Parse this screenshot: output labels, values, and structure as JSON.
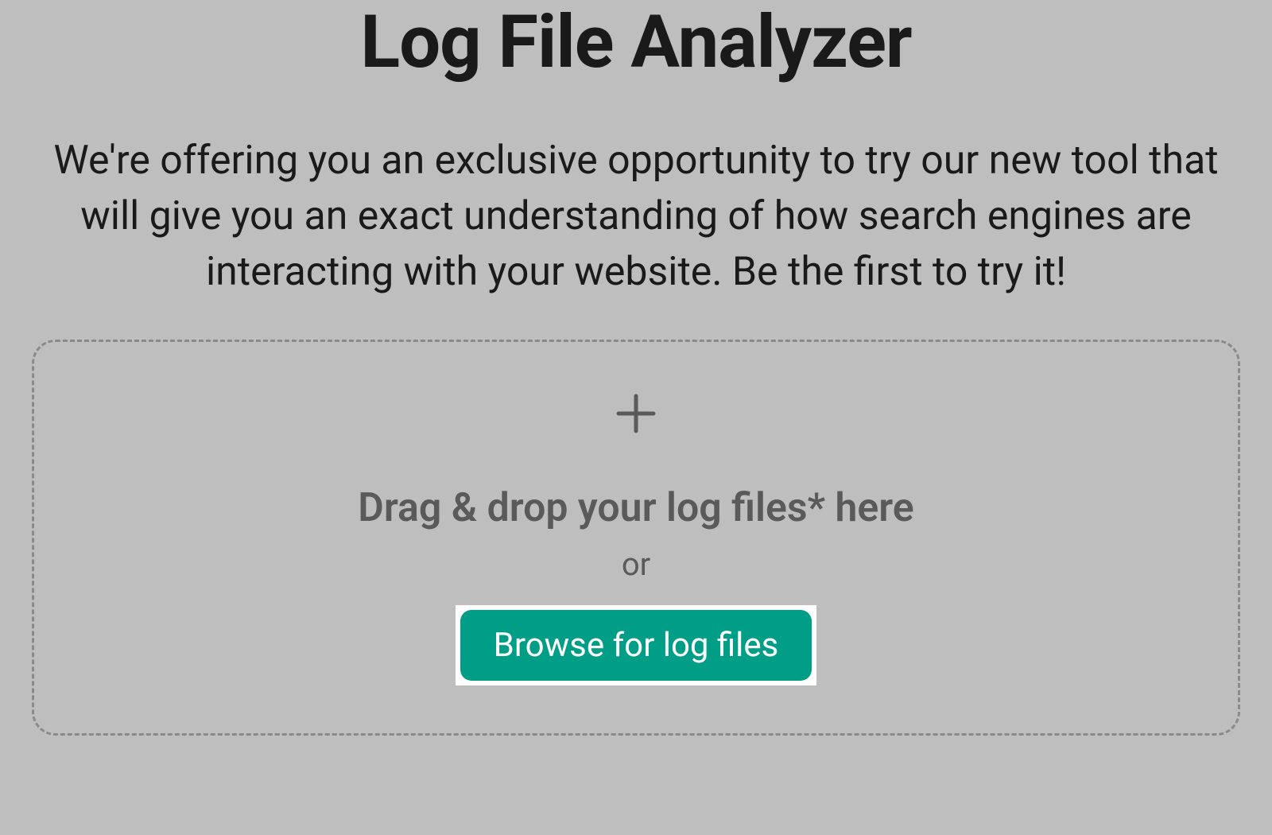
{
  "page": {
    "title": "Log File Analyzer",
    "description": "We're offering you an exclusive opportunity to try our new tool that will give you an exact understanding of how search engines are interacting with your website. Be the first to try it!"
  },
  "dropzone": {
    "main_text": "Drag & drop your log files* here",
    "or_text": "or",
    "button_label": "Browse for log files"
  },
  "colors": {
    "background": "#bebebe",
    "text_primary": "#1a1a1a",
    "text_secondary": "#5a5a5a",
    "border_dashed": "#8a8a8a",
    "button_bg": "#009e87",
    "button_text": "#ffffff"
  }
}
